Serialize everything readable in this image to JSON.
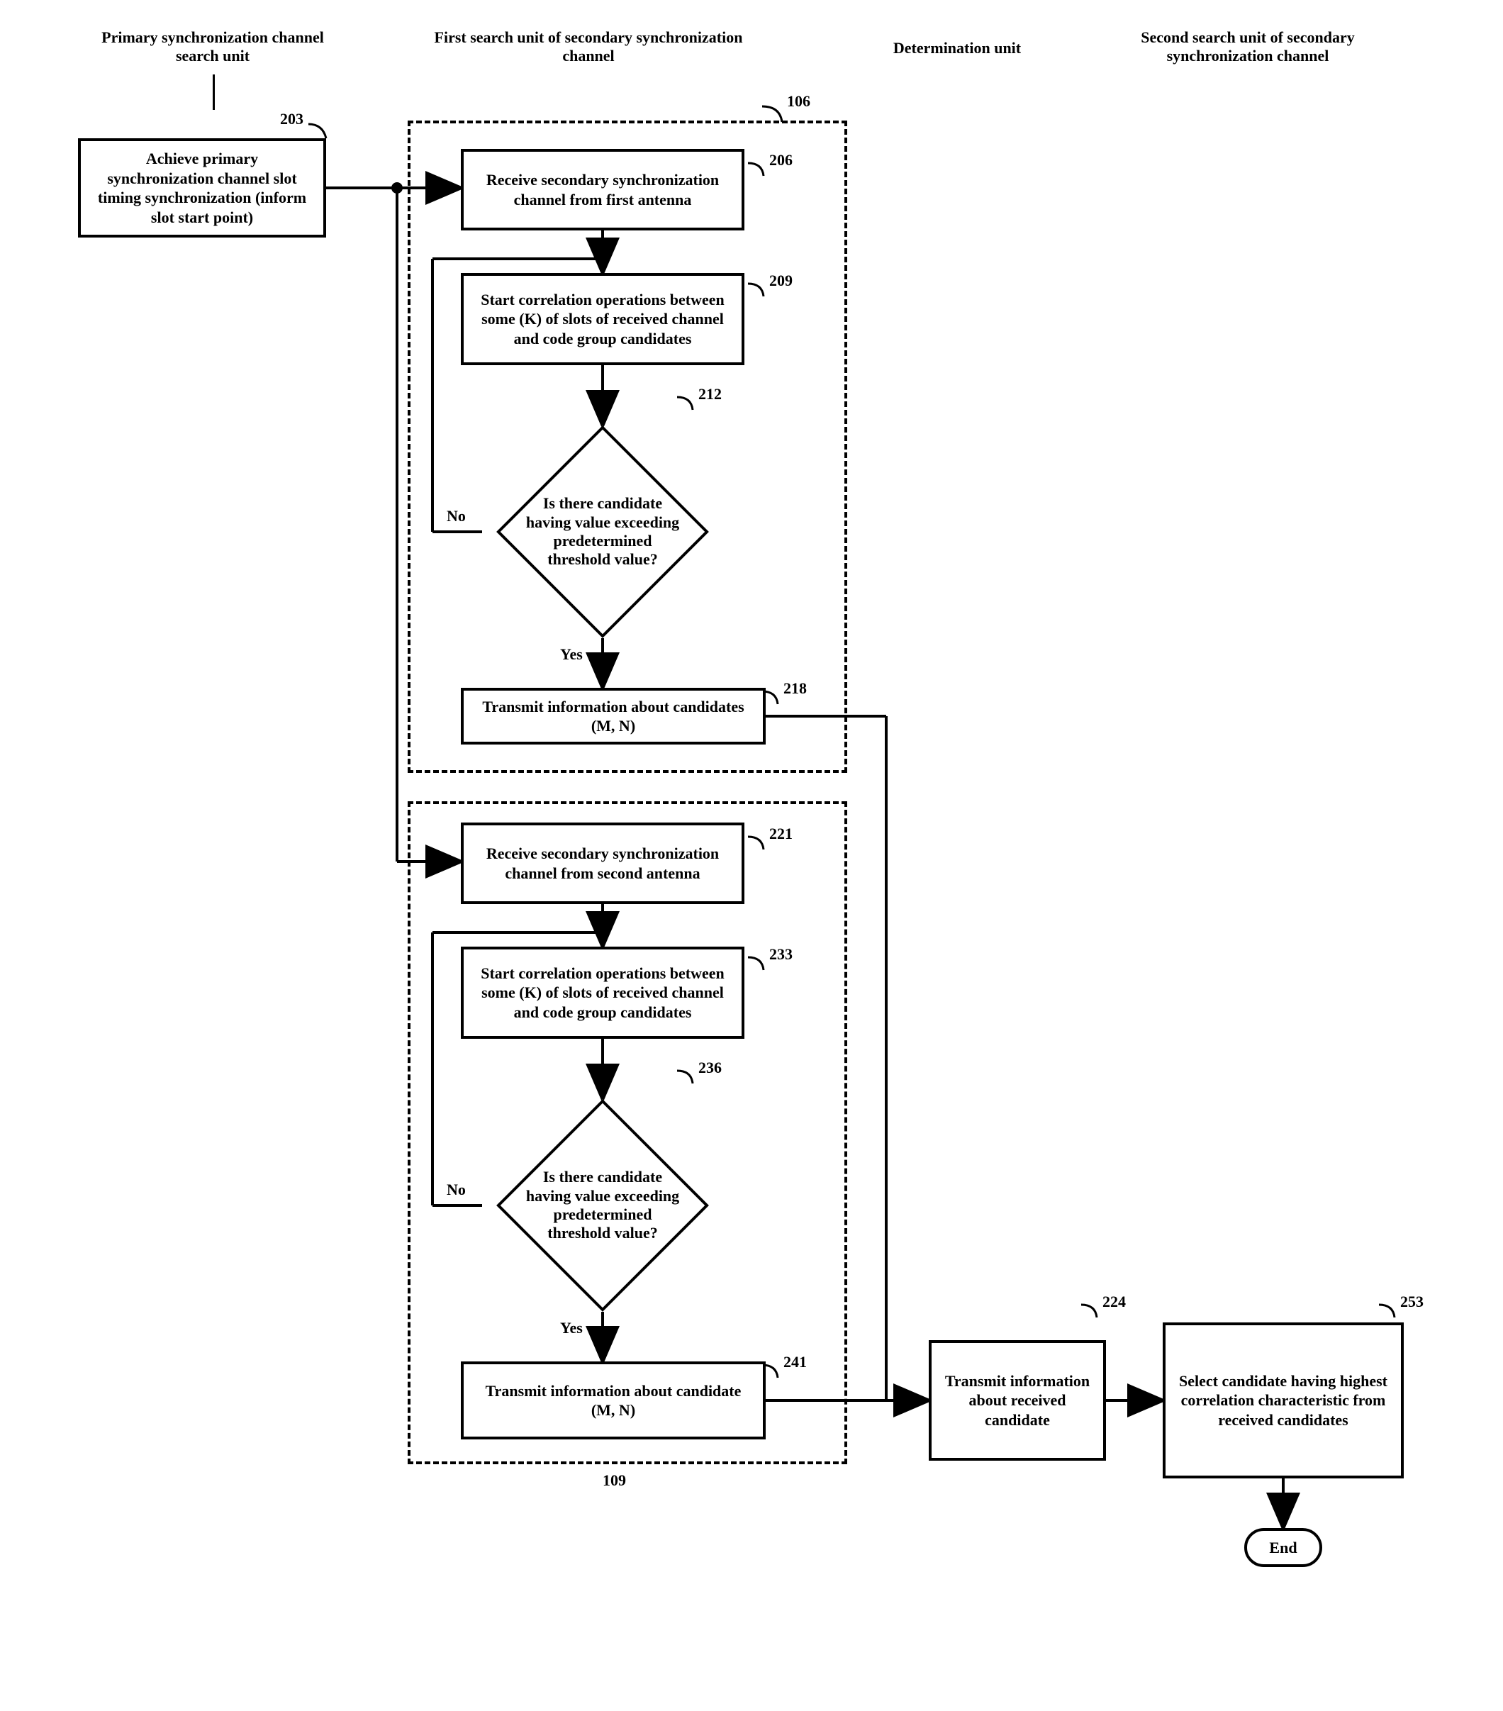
{
  "headers": {
    "primary": "Primary synchronization channel search unit",
    "first_search": "First search unit of secondary synchronization channel",
    "determination": "Determination unit",
    "second_search": "Second search unit of secondary synchronization channel"
  },
  "refs": {
    "r203": "203",
    "r106": "106",
    "r206": "206",
    "r209": "209",
    "r212": "212",
    "r218": "218",
    "r221": "221",
    "r233": "233",
    "r236": "236",
    "r241": "241",
    "r109": "109",
    "r224": "224",
    "r253": "253"
  },
  "boxes": {
    "b203": "Achieve primary synchronization channel slot timing synchronization (inform slot start point)",
    "b206": "Receive secondary synchronization channel from first antenna",
    "b209": "Start correlation operations between some (K) of slots of received channel and code group candidates",
    "d212": "Is there candidate having value exceeding predetermined threshold value?",
    "b218": "Transmit information about candidates (M, N)",
    "b221": "Receive secondary synchronization channel from second antenna",
    "b233": "Start correlation operations between some (K) of slots of received channel and code group candidates",
    "d236": "Is there candidate having value exceeding predetermined threshold value?",
    "b241": "Transmit information about candidate (M, N)",
    "b224": "Transmit information about received candidate",
    "b253": "Select candidate having highest correlation characteristic from received candidates"
  },
  "labels": {
    "no": "No",
    "yes": "Yes",
    "end": "End"
  }
}
